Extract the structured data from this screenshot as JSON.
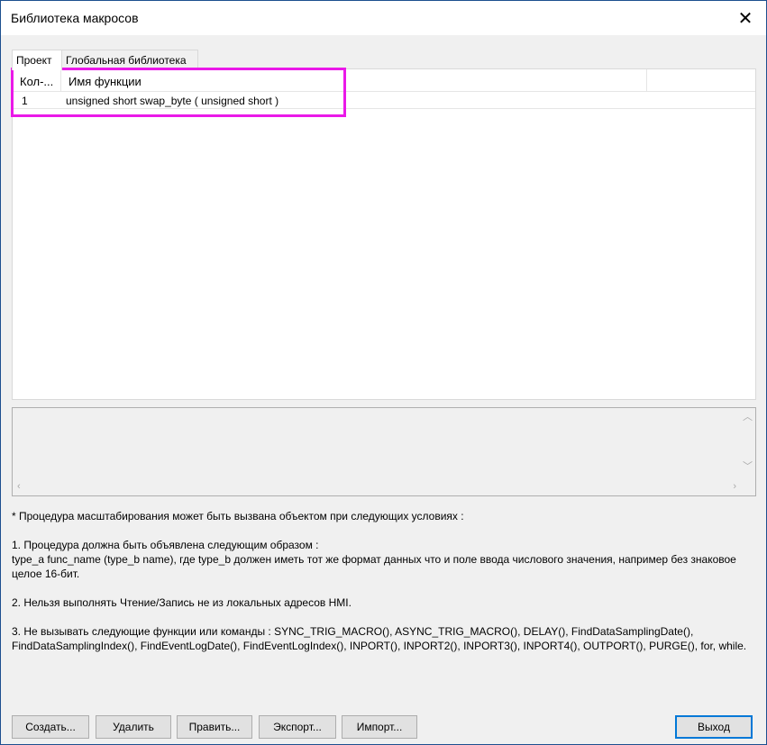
{
  "window": {
    "title": "Библиотека макросов"
  },
  "tabs": [
    {
      "label": "Проект",
      "active": true
    },
    {
      "label": "Глобальная библиотека",
      "active": false
    }
  ],
  "table": {
    "columns": [
      "Кол-...",
      "Имя функции"
    ],
    "rows": [
      {
        "count": "1",
        "name": "unsigned short swap_byte ( unsigned short )"
      }
    ]
  },
  "info": {
    "intro": "* Процедура масштабирования может быть вызвана объектом при следующих условиях :",
    "rule1_title": "1. Процедура должна быть объявлена следующим образом :",
    "rule1_body": "type_a func_name (type_b name), где type_b должен иметь тот же формат данных что и поле ввода числового значения, например без знаковое целое 16-бит.",
    "rule2": "2. Нельзя выполнять Чтение/Запись не из локальных адресов HMI.",
    "rule3": "3. Не вызывать следующие функции или команды : SYNC_TRIG_MACRO(), ASYNC_TRIG_MACRO(), DELAY(), FindDataSamplingDate(), FindDataSamplingIndex(), FindEventLogDate(), FindEventLogIndex(), INPORT(), INPORT2(), INPORT3(), INPORT4(), OUTPORT(), PURGE(), for, while."
  },
  "buttons": {
    "create": "Создать...",
    "delete": "Удалить",
    "edit": "Править...",
    "export": "Экспорт...",
    "import": "Импорт...",
    "exit": "Выход"
  },
  "colors": {
    "highlight": "#ea19e8",
    "default_button_border": "#0078d7"
  },
  "icons": {
    "close": "close-icon",
    "scroll_up": "chevron-up-icon",
    "scroll_down": "chevron-down-icon",
    "scroll_left": "chevron-left-icon",
    "scroll_right": "chevron-right-icon"
  }
}
